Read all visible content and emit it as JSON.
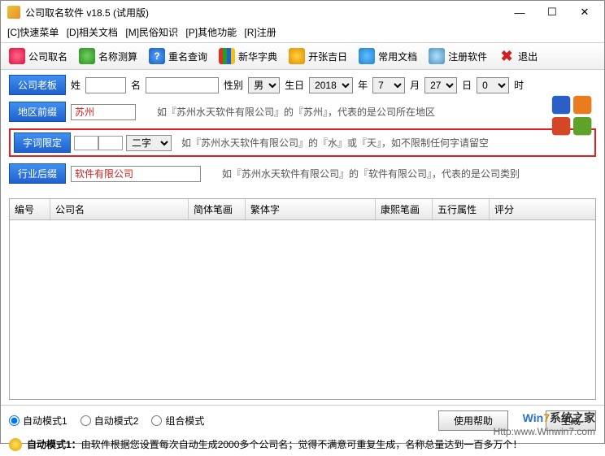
{
  "window": {
    "title": "公司取名软件 v18.5 (试用版)"
  },
  "menus": {
    "m1": "[C]快速菜单",
    "m2": "[D]相关文档",
    "m3": "[M]民俗知识",
    "m4": "[P]其他功能",
    "m5": "[R]注册"
  },
  "toolbar": {
    "t1": "公司取名",
    "t2": "名称测算",
    "t3": "重名查询",
    "t4": "新华字典",
    "t5": "开张吉日",
    "t6": "常用文档",
    "t7": "注册软件",
    "t8": "退出"
  },
  "form": {
    "boss": "公司老板",
    "surname_lbl": "姓",
    "given_lbl": "名",
    "gender_lbl": "性别",
    "gender_val": "男",
    "birth_lbl": "生日",
    "year": "2018",
    "year_unit": "年",
    "month": "7",
    "month_unit": "月",
    "day": "27",
    "day_unit": "日",
    "hour": "0",
    "hour_unit": "时",
    "region_btn": "地区前缀",
    "region_val": "苏州",
    "region_hint": "如『苏州水天软件有限公司』的『苏州』，代表的是公司所在地区",
    "limit_btn": "字词限定",
    "limit_sel": "二字",
    "limit_hint": "如『苏州水天软件有限公司』的『水』或『天』，如不限制任何字请留空",
    "suffix_btn": "行业后缀",
    "suffix_val": "软件有限公司",
    "suffix_hint": "如『苏州水天软件有限公司』的『软件有限公司』，代表的是公司类别"
  },
  "columns": {
    "c1": "编号",
    "c2": "公司名",
    "c3": "简体笔画",
    "c4": "繁体字",
    "c5": "康熙笔画",
    "c6": "五行属性",
    "c7": "评分"
  },
  "modes": {
    "auto1": "自动模式1",
    "auto2": "自动模式2",
    "combo": "组合模式"
  },
  "buttons": {
    "help": "使用帮助",
    "gen": "生成"
  },
  "footer": {
    "label": "自动模式1：",
    "text": "由软件根据您设置每次自动生成2000多个公司名；觉得不满意可重复生成，名称总量达到一百多万个！"
  },
  "watermark": {
    "brand_pre": "Win",
    "brand_num": "7",
    "brand_zh": "系统之家",
    "url": "Http:www.Winwin7.com"
  }
}
